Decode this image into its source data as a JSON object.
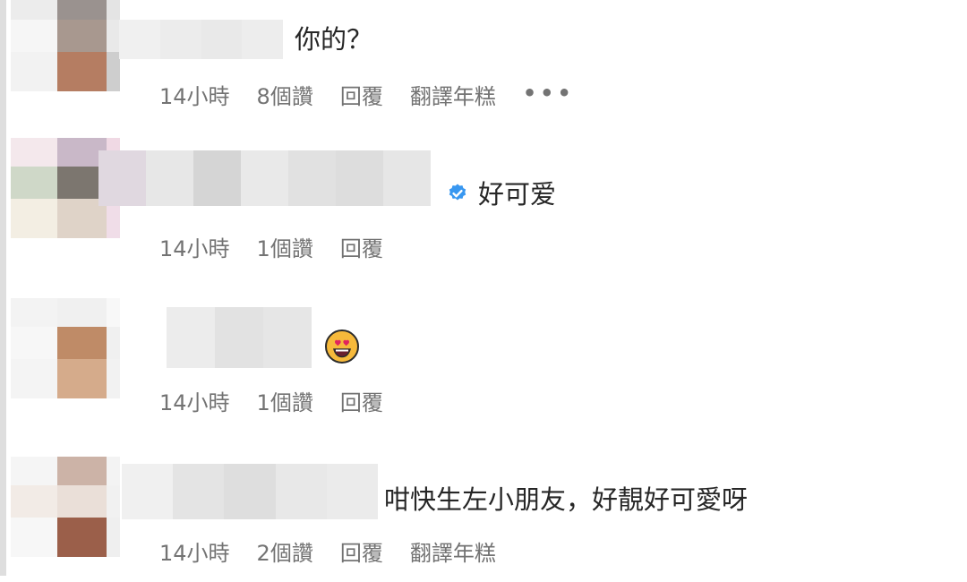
{
  "comments": [
    {
      "text": "你的？",
      "meta": {
        "time": "14小時",
        "likes": "8個讚",
        "reply": "回覆",
        "translate": "翻譯年糕",
        "more": "•••"
      }
    },
    {
      "text": "好可爱",
      "meta": {
        "time": "14小時",
        "likes": "1個讚",
        "reply": "回覆"
      }
    },
    {
      "text": "",
      "meta": {
        "time": "14小時",
        "likes": "1個讚",
        "reply": "回覆"
      }
    },
    {
      "text": "咁快生左小朋友，好靚好可愛呀",
      "meta": {
        "time": "14小時",
        "likes": "2個讚",
        "reply": "回覆",
        "translate": "翻譯年糕"
      }
    }
  ],
  "icons": {
    "verified": "verified-badge-icon",
    "emoji": "heart-eyes-emoji-icon"
  },
  "colors": {
    "text": "#262626",
    "meta": "#737373",
    "verified": "#3897f0"
  }
}
